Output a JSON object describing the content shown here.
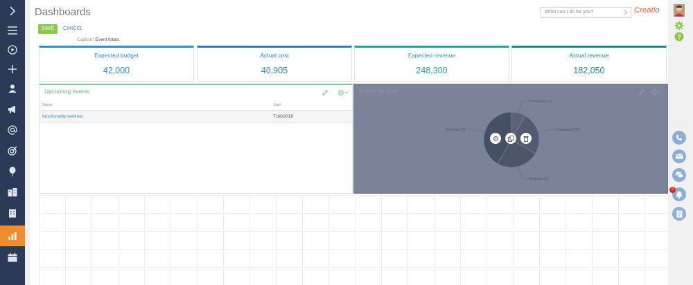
{
  "header": {
    "title": "Dashboards",
    "search_placeholder": "What can I do for you?",
    "logo": "Creatio"
  },
  "toolbar": {
    "save_label": "SAVE",
    "cancel_label": "CANCEL",
    "caption_label": "Caption*",
    "caption_value": "Event totals"
  },
  "kpis": [
    {
      "label": "Expected budget",
      "value": "42,000",
      "color": "#2f8dc9"
    },
    {
      "label": "Actual cost",
      "value": "40,905",
      "color": "#2f7fb8"
    },
    {
      "label": "Expected revenue",
      "value": "248,300",
      "color": "#27a0a0"
    },
    {
      "label": "Actual revenue",
      "value": "182,050",
      "color": "#1e8a8a"
    }
  ],
  "events_panel": {
    "title": "Upcoming events",
    "columns": [
      "Name",
      "Start"
    ],
    "rows": [
      {
        "name": "functionality webinar",
        "start": "7/16/2018"
      }
    ]
  },
  "chart_panel": {
    "title": "Events by type"
  },
  "chart_data": {
    "type": "pie",
    "categories": [
      "Promotion",
      "Exhibition",
      "Seminar",
      "Webinar"
    ],
    "values": [
      1,
      3,
      3,
      5
    ],
    "labels": [
      "Promotion (1)",
      "Exhibition (3)",
      "Seminar (3)",
      "Webinar (5)"
    ],
    "colors": [
      "#5a6278",
      "#535b70",
      "#4d5569",
      "#465063"
    ]
  },
  "right_bar": {
    "notification_count": "9"
  },
  "colors": {
    "sidebar": "#2b3a55",
    "active": "#f08b2e",
    "save": "#8bc94a",
    "link": "#3d83c9",
    "accent_green": "#6fcf97"
  }
}
